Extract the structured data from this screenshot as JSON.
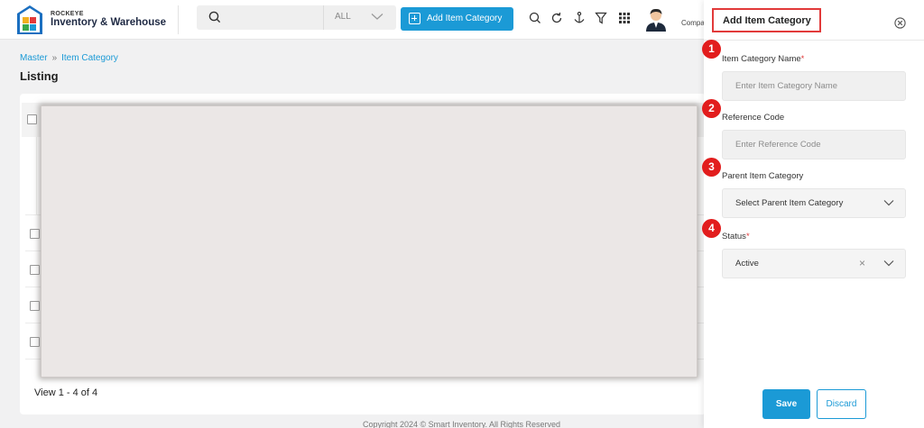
{
  "brand": {
    "company": "ROCKEYE",
    "product": "Inventory & Warehouse"
  },
  "search": {
    "placeholder": "",
    "scope": "ALL"
  },
  "toolbar": {
    "add_label": "Add Item Category",
    "icons": [
      "search-icon",
      "refresh-icon",
      "anchor-icon",
      "filter-icon",
      "apps-grid-icon"
    ],
    "company_label": "Compa"
  },
  "breadcrumb": {
    "root": "Master",
    "current": "Item Category"
  },
  "page": {
    "title": "Listing",
    "view_count": "View 1 - 4 of 4"
  },
  "footer": {
    "copyright": "Copyright 2024 © Smart Inventory. All Rights Reserved"
  },
  "panel": {
    "title": "Add Item Category",
    "fields": [
      {
        "badge": "1",
        "label": "Item Category Name",
        "required": "*",
        "placeholder": "Enter Item Category Name"
      },
      {
        "badge": "2",
        "label": "Reference Code",
        "required": "",
        "placeholder": "Enter Reference Code"
      },
      {
        "badge": "3",
        "label": "Parent Item Category",
        "required": "",
        "placeholder": "Select Parent Item Category"
      },
      {
        "badge": "4",
        "label": "Status",
        "required": "*",
        "value": "Active"
      }
    ],
    "save_label": "Save",
    "discard_label": "Discard"
  },
  "colors": {
    "accent": "#1b9ad6",
    "badge": "#e21d1d",
    "highlight_border": "#e23a3a"
  }
}
